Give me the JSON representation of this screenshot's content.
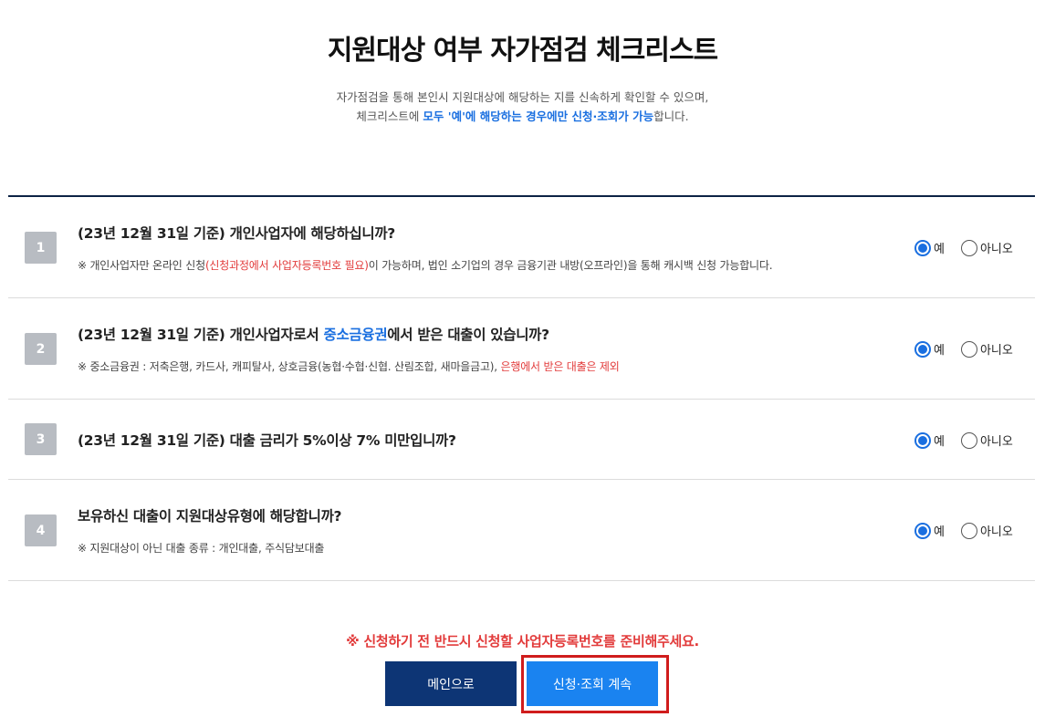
{
  "page": {
    "title": "지원대상 여부 자가점검 체크리스트",
    "intro_line1": "자가점검을 통해 본인시 지원대상에 해당하는 지를 신속하게 확인할 수 있으며,",
    "intro_line2_pre": "체크리스트에 ",
    "intro_line2_hl": "모두 '예'에 해당하는 경우에만 신청·조회가 가능",
    "intro_line2_post": "합니다."
  },
  "questions": [
    {
      "num": "1",
      "title": "(23년 12월 31일 기준) 개인사업자에 해당하십니까?",
      "note_pre": "※ 개인사업자만 온라인 신청",
      "note_red": "(신청과정에서 사업자등록번호 필요)",
      "note_post": "이 가능하며, 법인 소기업의 경우 금융기관 내방(오프라인)을 통해 캐시백 신청 가능합니다.",
      "yes_label": "예",
      "no_label": "아니오",
      "selected": "yes"
    },
    {
      "num": "2",
      "title_pre": "(23년 12월 31일 기준) 개인사업자로서 ",
      "title_blue": "중소금융권",
      "title_post": "에서 받은 대출이 있습니까?",
      "note_pre": "※ 중소금융권 : 저축은행, 카드사, 캐피탈사, 상호금융(농협·수협·신협. 산림조합, 새마을금고), ",
      "note_red": "은행에서 받은 대출은 제외",
      "yes_label": "예",
      "no_label": "아니오",
      "selected": "yes"
    },
    {
      "num": "3",
      "title": "(23년 12월 31일 기준) 대출 금리가 5%이상 7% 미만입니까?",
      "yes_label": "예",
      "no_label": "아니오",
      "selected": "yes"
    },
    {
      "num": "4",
      "title": "보유하신 대출이 지원대상유형에 해당합니까?",
      "note_pre": "※ 지원대상이 아닌 대출 종류 : 개인대출, 주식담보대출",
      "yes_label": "예",
      "no_label": "아니오",
      "selected": "yes"
    }
  ],
  "footer": {
    "notice": "※ 신청하기 전 반드시 신청할 사업자등록번호를 준비해주세요.",
    "main_button": "메인으로",
    "continue_button": "신청·조회 계속"
  },
  "colors": {
    "accent_blue": "#1a6fe0",
    "notice_red": "#e23b3b",
    "main_button_bg": "#0d3575",
    "continue_button_bg": "#1a83f0",
    "highlight_border": "#d01c1c"
  }
}
